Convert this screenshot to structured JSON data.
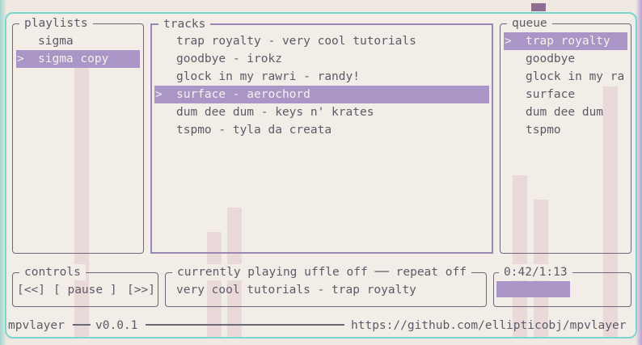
{
  "playlists": {
    "title": "playlists",
    "items": [
      {
        "marker": "",
        "label": "sigma"
      },
      {
        "marker": ">",
        "label": "sigma copy"
      }
    ]
  },
  "tracks": {
    "title": "tracks",
    "items": [
      {
        "marker": "",
        "label": "trap royalty - very cool tutorials"
      },
      {
        "marker": "",
        "label": "goodbye - irokz"
      },
      {
        "marker": "",
        "label": "glock in my rawri - randy!"
      },
      {
        "marker": ">",
        "label": "surface - aerochord"
      },
      {
        "marker": "",
        "label": "dum dee dum - keys n' krates"
      },
      {
        "marker": "",
        "label": "tspmo - tyla da creata"
      }
    ]
  },
  "queue": {
    "title": "queue",
    "items": [
      {
        "marker": ">",
        "label": "trap royalty"
      },
      {
        "marker": "",
        "label": "goodbye"
      },
      {
        "marker": "",
        "label": "glock in my ra"
      },
      {
        "marker": "",
        "label": "surface"
      },
      {
        "marker": "",
        "label": "dum dee dum"
      },
      {
        "marker": "",
        "label": "tspmo"
      }
    ]
  },
  "controls": {
    "title": "controls",
    "prev": "[<<]",
    "pause": "[ pause ]",
    "next": "[>>]"
  },
  "now_playing": {
    "title": "currently playing",
    "shuffle": "uffle off",
    "repeat": "repeat off",
    "track": "very cool tutorials - trap royalty"
  },
  "time": {
    "label": "0:42/1:13",
    "progress_fraction": 0.575
  },
  "footer": {
    "app_name": "mpvlayer",
    "version": "v0.0.1",
    "url": "https://github.com/ellipticobj/mpvlayer"
  },
  "colors": {
    "selection": "#a996c6",
    "frame": "#7ad6cf",
    "border": "#6b6877",
    "text": "#5d5a68"
  }
}
